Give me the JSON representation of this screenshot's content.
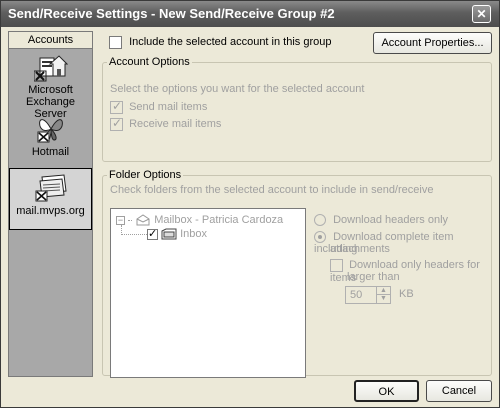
{
  "window": {
    "title": "Send/Receive Settings - New Send/Receive Group #2"
  },
  "accounts": {
    "header": "Accounts",
    "items": [
      {
        "label": "Microsoft Exchange Server",
        "icon": "exchange-server-icon",
        "selected": false
      },
      {
        "label": "Hotmail",
        "icon": "hotmail-butterfly-icon",
        "selected": false
      },
      {
        "label": "mail.mvps.org",
        "icon": "pop-mail-account-icon",
        "selected": true
      }
    ]
  },
  "include": {
    "label": "Include the selected account in this group",
    "checked": false
  },
  "account_properties_button": "Account Properties...",
  "account_options": {
    "legend": "Account Options",
    "hint": "Select the options you want for the selected account",
    "send_mail_items": {
      "label": "Send mail items",
      "checked": true,
      "disabled": true
    },
    "receive_mail_items": {
      "label": "Receive mail items",
      "checked": true,
      "disabled": true
    }
  },
  "folder_options": {
    "legend": "Folder Options",
    "hint": "Check folders from the selected account to include in send/receive",
    "tree": {
      "root": "Mailbox - Patricia Cardoza",
      "child": "Inbox",
      "child_checked": true
    },
    "download_headers_only": "Download headers only",
    "download_complete_line1": "Download complete item including",
    "download_complete_line2": "attachments",
    "download_only_headers_line1": "Download only headers for items",
    "download_only_headers_line2": "larger than",
    "size_value": "50",
    "size_unit": "KB",
    "selected_radio": "download_complete"
  },
  "footer": {
    "ok": "OK",
    "cancel": "Cancel"
  }
}
